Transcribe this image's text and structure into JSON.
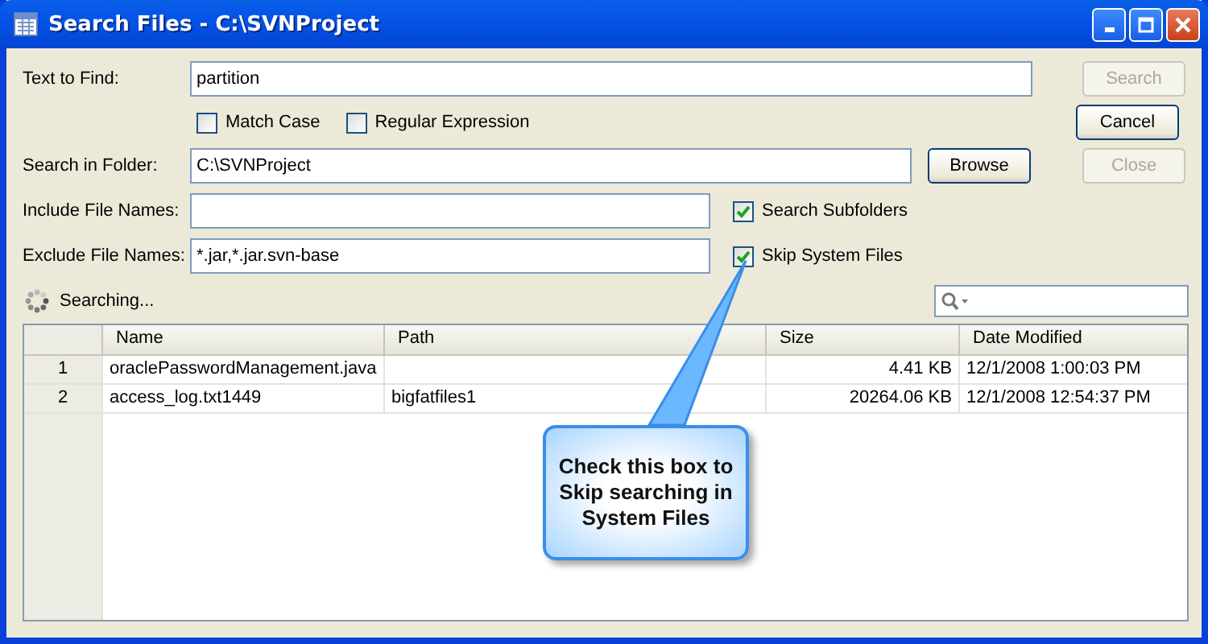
{
  "window": {
    "title": "Search Files - C:\\SVNProject"
  },
  "form": {
    "text_to_find": {
      "label": "Text to Find:",
      "value": "partition"
    },
    "options": [
      {
        "label": "Match Case",
        "checked": false
      },
      {
        "label": "Regular Expression",
        "checked": false
      }
    ],
    "search_in_folder": {
      "label": "Search in Folder:",
      "value": "C:\\SVNProject"
    },
    "include_file_names": {
      "label": "Include File Names:"
    },
    "exclude_file_names": {
      "label": "Exclude File Names:",
      "value": "*.jar,*.jar.svn-base"
    },
    "search_subfolders": {
      "label": "Search Subfolders",
      "checked": true
    },
    "skip_system_files": {
      "label": "Skip System Files",
      "checked": true
    }
  },
  "buttons": [
    {
      "label": "Search",
      "disabled": true
    },
    {
      "label": "Cancel",
      "disabled": false
    },
    {
      "label": "Browse",
      "disabled": false
    },
    {
      "label": "Close",
      "disabled": true
    }
  ],
  "status": {
    "text": "Searching..."
  },
  "table": {
    "columns": [
      "Name",
      "Path",
      "Size",
      "Date Modified"
    ],
    "rows": [
      {
        "number": "1",
        "name": "oraclePasswordManagement.java",
        "size": "4.41 KB",
        "date_modified": "12/1/2008 1:00:03 PM"
      },
      {
        "number": "2",
        "name": "access_log.txt1449",
        "path": "bigfatfiles1",
        "size": "20264.06 KB",
        "date_modified": "12/1/2008 12:54:37 PM"
      }
    ]
  },
  "callout": {
    "text": "Check this box to Skip searching in System Files"
  }
}
